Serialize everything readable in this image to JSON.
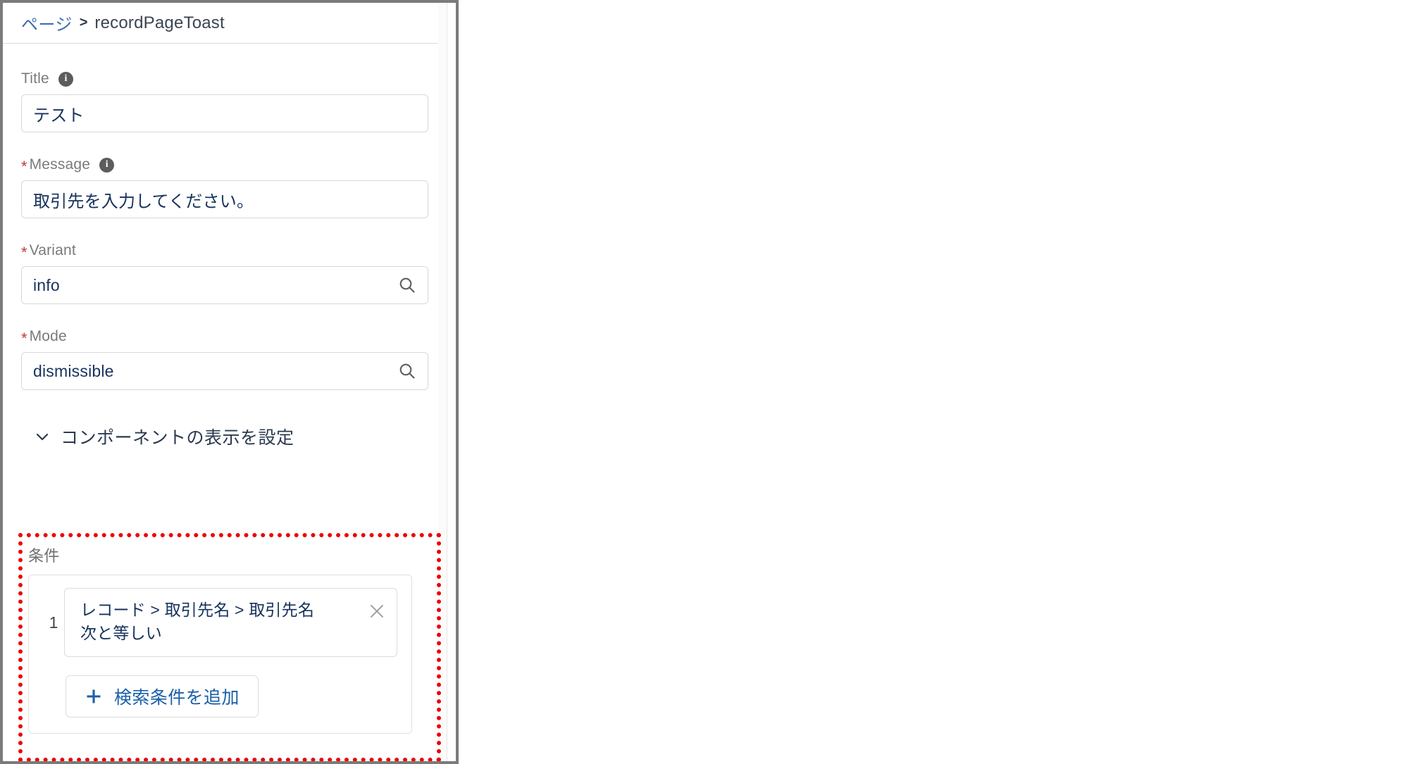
{
  "breadcrumb": {
    "parent_label": "ページ",
    "separator": ">",
    "current_label": "recordPageToast"
  },
  "fields": [
    {
      "label": "Title",
      "required": false,
      "has_info": true,
      "info_glyph": "i",
      "value": "テスト",
      "icon": null
    },
    {
      "label": "Message",
      "required": true,
      "has_info": true,
      "info_glyph": "i",
      "value": "取引先を入力してください。",
      "icon": null
    },
    {
      "label": "Variant",
      "required": true,
      "has_info": false,
      "value": "info",
      "icon": "search-icon"
    },
    {
      "label": "Mode",
      "required": true,
      "has_info": false,
      "value": "dismissible",
      "icon": "search-icon"
    }
  ],
  "section": {
    "chevron": "chevron-down-icon",
    "title": "コンポーネントの表示を設定"
  },
  "condition": {
    "label": "条件",
    "items": [
      {
        "index": "1",
        "line1": "レコード > 取引先名 > 取引先名",
        "line2": "次と等しい",
        "remove_icon": "close-icon"
      }
    ],
    "add_button": {
      "icon": "plus-icon",
      "label": "検索条件を追加"
    }
  },
  "colors": {
    "link_blue": "#3c6db0",
    "value_navy": "#16325c",
    "label_gray": "#7a7a7a",
    "required_red": "#c23934",
    "highlight_red": "#ee0000",
    "panel_border": "#7b7b7b",
    "input_border": "#d8d8d8",
    "add_button_blue": "#1a5fa8"
  }
}
